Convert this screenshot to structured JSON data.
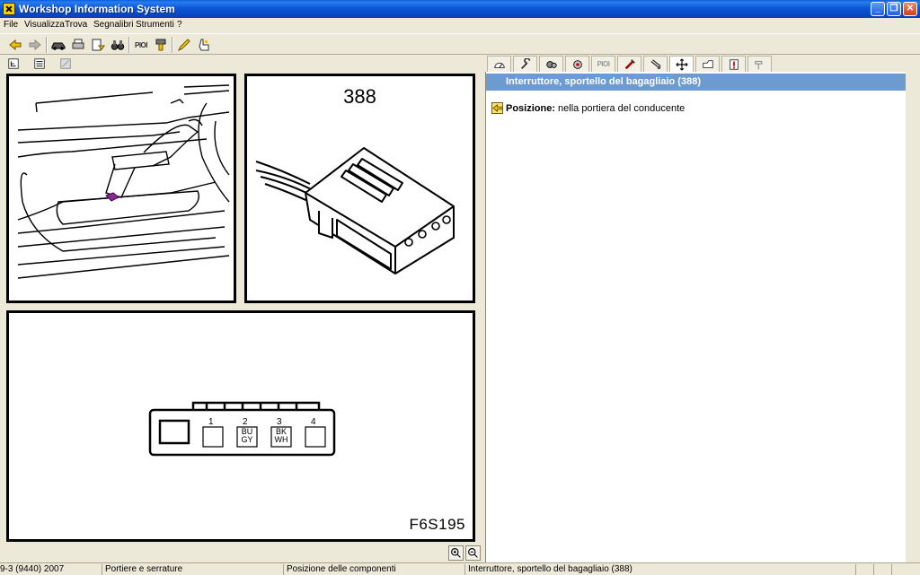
{
  "window": {
    "title": "Workshop Information System"
  },
  "menu": {
    "items": [
      {
        "label": "File"
      },
      {
        "label": "Visualizza"
      },
      {
        "label": "Trova"
      },
      {
        "label": "Segnalibri"
      },
      {
        "label": "Strumenti"
      },
      {
        "label": "?"
      }
    ]
  },
  "toolbar": {
    "pioi_label": "PIOI"
  },
  "right_tabs": {
    "pioi_label": "PIOI"
  },
  "figures": {
    "connector_number": "388",
    "connector_code": "F6S195",
    "pins": [
      {
        "num": "1",
        "color1": "",
        "color2": ""
      },
      {
        "num": "2",
        "color1": "BU",
        "color2": "GY"
      },
      {
        "num": "3",
        "color1": "BK",
        "color2": "WH"
      },
      {
        "num": "4",
        "color1": "",
        "color2": ""
      }
    ]
  },
  "info": {
    "header": "Interruttore, sportello del bagagliaio (388)",
    "position_label": "Posizione:",
    "position_value": "nella portiera del conducente"
  },
  "status": {
    "vehicle": "9-3 (9440) 2007",
    "section": "Portiere e serrature",
    "view": "Posizione delle componenti",
    "component": "Interruttore, sportello del bagagliaio (388)"
  },
  "colors": {
    "header_bg": "#6d9bd0",
    "titlebar": "#0b56d6",
    "window_bg": "#ece9d8"
  }
}
